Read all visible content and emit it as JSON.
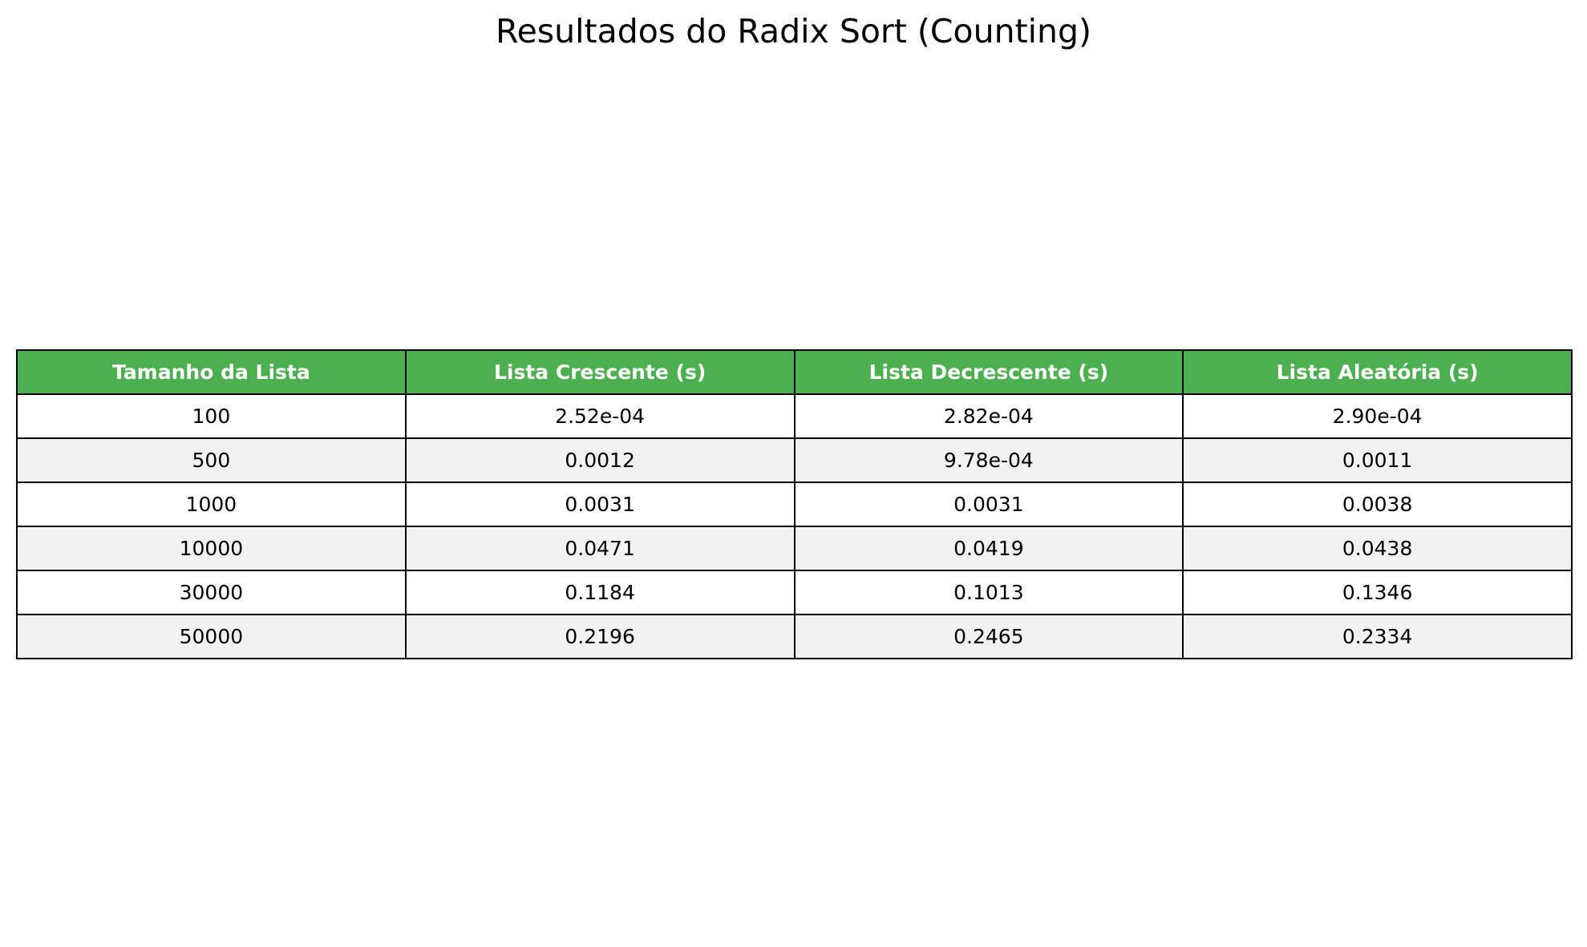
{
  "chart_data": {
    "type": "table",
    "title": "Resultados do Radix Sort (Counting)",
    "columns": [
      "Tamanho da Lista",
      "Lista Crescente (s)",
      "Lista Decrescente (s)",
      "Lista Aleatória (s)"
    ],
    "rows": [
      [
        "100",
        "2.52e-04",
        "2.82e-04",
        "2.90e-04"
      ],
      [
        "500",
        "0.0012",
        "9.78e-04",
        "0.0011"
      ],
      [
        "1000",
        "0.0031",
        "0.0031",
        "0.0038"
      ],
      [
        "10000",
        "0.0471",
        "0.0419",
        "0.0438"
      ],
      [
        "30000",
        "0.1184",
        "0.1013",
        "0.1346"
      ],
      [
        "50000",
        "0.2196",
        "0.2465",
        "0.2334"
      ]
    ],
    "header_color": "#4caf50",
    "header_text_color": "#ffffff",
    "stripe_color": "#f2f2f2",
    "border_color": "#000000"
  }
}
